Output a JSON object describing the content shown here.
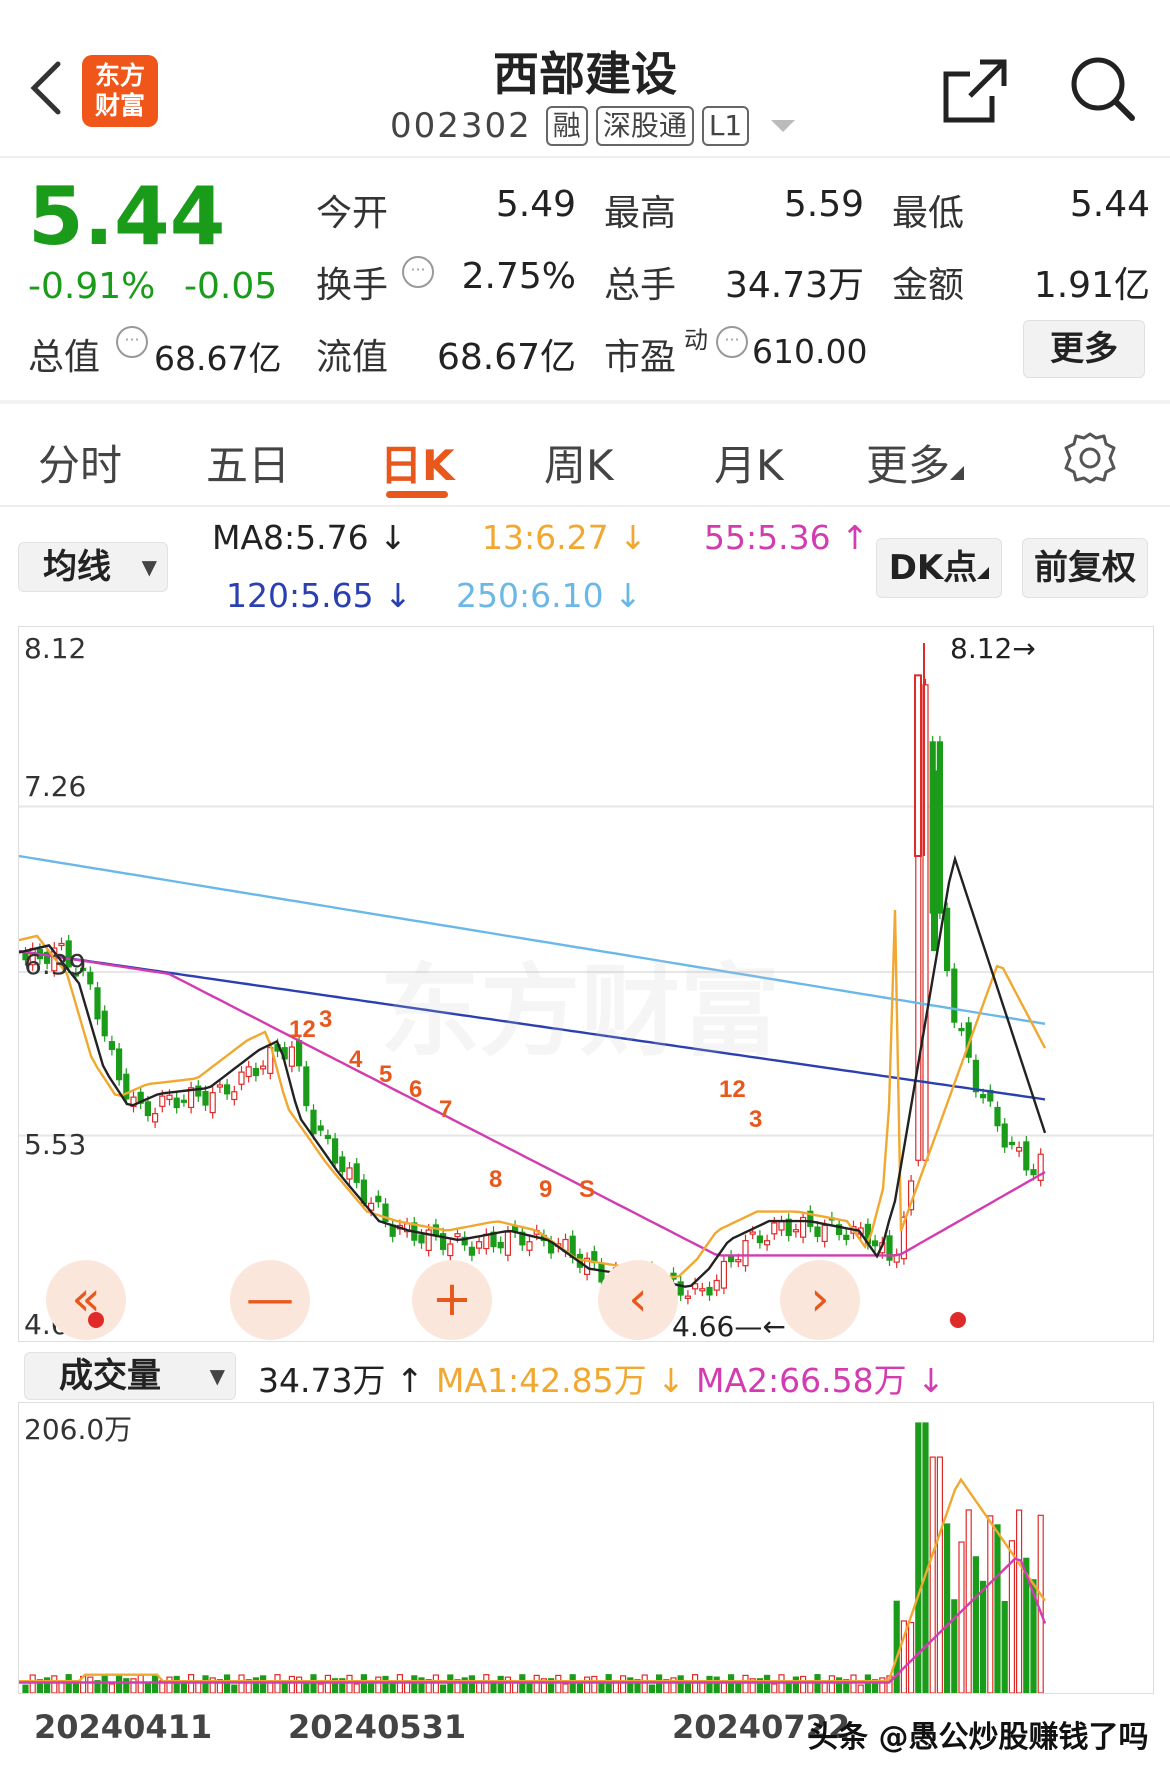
{
  "header": {
    "back_icon": "chevron-left-icon",
    "logo_text": [
      "东方",
      "财富"
    ],
    "stock_name": "西部建设",
    "stock_code": "002302",
    "tags": [
      "融",
      "深股通",
      "L1"
    ],
    "share_icon": "share-icon",
    "search_icon": "search-icon"
  },
  "quote": {
    "price": "5.44",
    "change_pct": "-0.91%",
    "change": "-0.05",
    "open_label": "今开",
    "open": "5.49",
    "high_label": "最高",
    "high": "5.59",
    "low_label": "最低",
    "low": "5.44",
    "turnover_label": "换手",
    "turnover": "2.75%",
    "volume_label": "总手",
    "volume": "34.73万",
    "amount_label": "金额",
    "amount": "1.91亿",
    "mktcap_label": "总值",
    "mktcap": "68.67亿",
    "float_label": "流值",
    "float_cap": "68.67亿",
    "pe_label": "市盈",
    "pe_sup": "动",
    "pe": "610.00",
    "more_label": "更多",
    "colors": {
      "down": "#1a9c1a",
      "up": "#e02a2a"
    }
  },
  "tabs": {
    "items": [
      "分时",
      "五日",
      "日K",
      "周K",
      "月K",
      "更多"
    ],
    "active": "日K",
    "settings_icon": "gear-icon"
  },
  "indicators": {
    "ma_selector": "均线",
    "ma8": "MA8:5.76",
    "ma13": "13:6.27",
    "ma55": "55:5.36",
    "ma120": "120:5.65",
    "ma250": "250:6.10",
    "dk_label": "DK点",
    "adjust_label": "前复权",
    "colors": {
      "ma8": "#222222",
      "ma13": "#f0a830",
      "ma55": "#d23cb0",
      "ma120": "#2a3fb0",
      "ma250": "#6ab8e8"
    }
  },
  "kchart": {
    "y_ticks": [
      "8.12",
      "7.26",
      "6.39",
      "5.53",
      "4.66"
    ],
    "max_label": "8.12",
    "min_label": "4.66",
    "ctrl_icons": [
      "double-left-icon",
      "minus-icon",
      "plus-icon",
      "left-icon",
      "right-icon"
    ],
    "ctrl_glyphs": [
      "«",
      "—",
      "+",
      "‹",
      "›"
    ],
    "signal_marks": [
      "12",
      "3",
      "4",
      "5",
      "6",
      "7",
      "8",
      "9",
      "S"
    ]
  },
  "volume": {
    "selector": "成交量",
    "value": "34.73万",
    "ma1": "MA1:42.85万",
    "ma2": "MA2:66.58万",
    "max_tick": "206.0万",
    "colors": {
      "ma1": "#f0a830",
      "ma2": "#d23cb0"
    }
  },
  "x_dates": [
    "20240411",
    "20240531",
    "20240722"
  ],
  "watermark": "头条 @愚公炒股赚钱了吗",
  "bg_watermark": "东方财富",
  "chart_data": [
    {
      "type": "candlestick",
      "title": "西部建设 日K",
      "ylim": [
        4.66,
        8.12
      ],
      "y_ticks": [
        8.12,
        7.26,
        6.39,
        5.53,
        4.66
      ],
      "x_dates": [
        "20240411",
        "20240531",
        "20240722"
      ],
      "annotations": [
        "8.12",
        "4.66"
      ],
      "series": [
        {
          "name": "MA8",
          "value": 5.76
        },
        {
          "name": "13",
          "value": 6.27
        },
        {
          "name": "55",
          "value": 5.36
        },
        {
          "name": "120",
          "value": 5.65
        },
        {
          "name": "250",
          "value": 6.1
        }
      ]
    },
    {
      "type": "bar",
      "title": "成交量",
      "ylim": [
        0,
        206.0
      ],
      "unit": "万",
      "series": [
        {
          "name": "MA1",
          "value": 42.85
        },
        {
          "name": "MA2",
          "value": 66.58
        }
      ]
    }
  ]
}
